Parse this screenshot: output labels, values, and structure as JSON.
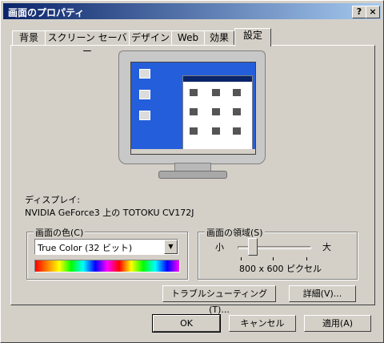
{
  "window": {
    "title": "画面のプロパティ",
    "help_label": "?",
    "close_label": "×"
  },
  "tabs": [
    {
      "label": "背景"
    },
    {
      "label": "スクリーン セーバー"
    },
    {
      "label": "デザイン"
    },
    {
      "label": "Web"
    },
    {
      "label": "効果"
    },
    {
      "label": "設定"
    }
  ],
  "display": {
    "label": "ディスプレイ:",
    "device": "NVIDIA GeForce3 上の TOTOKU CV172J"
  },
  "colors": {
    "group_title": "画面の色(C)",
    "selected": "True Color (32 ビット)"
  },
  "resolution": {
    "group_title": "画面の領域(S)",
    "small": "小",
    "large": "大",
    "value_text": "800 x 600 ピクセル",
    "slider_fraction": 0.2
  },
  "buttons": {
    "troubleshoot": "トラブルシューティング(T)...",
    "advanced": "詳細(V)...",
    "ok": "OK",
    "cancel": "キャンセル",
    "apply": "適用(A)"
  }
}
